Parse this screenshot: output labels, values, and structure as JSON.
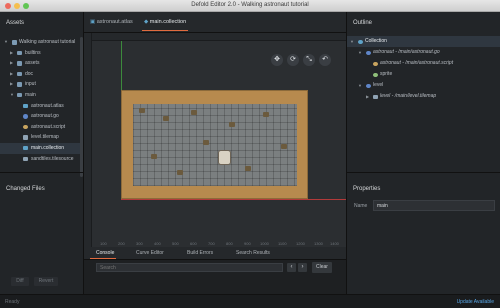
{
  "window": {
    "title": "Defold Editor 2.0 - Walking astronaut tutorial"
  },
  "assets": {
    "heading": "Assets",
    "items": [
      {
        "label": "Walking astronaut tutorial",
        "icon": "folder-icon",
        "color": "#7c9ab3",
        "expanded": true
      },
      {
        "label": "builtins",
        "icon": "folder-icon",
        "color": "#7c9ab3",
        "expanded": false
      },
      {
        "label": "assets",
        "icon": "folder-icon",
        "color": "#7c9ab3",
        "expanded": false
      },
      {
        "label": "doc",
        "icon": "folder-icon",
        "color": "#7c9ab3",
        "expanded": false
      },
      {
        "label": "input",
        "icon": "folder-icon",
        "color": "#7c9ab3",
        "expanded": false
      },
      {
        "label": "main",
        "icon": "folder-icon",
        "color": "#7c9ab3",
        "expanded": true
      },
      {
        "label": "astronaut.atlas",
        "icon": "atlas-icon",
        "color": "#5fa3c8"
      },
      {
        "label": "astronaut.go",
        "icon": "gameobject-icon",
        "color": "#5f86c8"
      },
      {
        "label": "astronaut.script",
        "icon": "script-icon",
        "color": "#c8a45f"
      },
      {
        "label": "level.tilemap",
        "icon": "tilemap-icon",
        "color": "#8fa3b4"
      },
      {
        "label": "main.collection",
        "icon": "collection-icon",
        "color": "#5fa3c8",
        "selected": true
      },
      {
        "label": "sandtiles.tilesource",
        "icon": "tilesource-icon",
        "color": "#8fa3b4"
      }
    ]
  },
  "changed_files": {
    "heading": "Changed Files",
    "diff_label": "Diff",
    "revert_label": "Revert"
  },
  "editor": {
    "tabs": [
      {
        "label": "astronaut.atlas",
        "active": false
      },
      {
        "label": "main.collection",
        "active": true
      }
    ],
    "ruler_ticks": [
      "100",
      "200",
      "300",
      "400",
      "500",
      "600",
      "700",
      "800",
      "900",
      "1000",
      "1100",
      "1200",
      "1300",
      "1400"
    ],
    "toolbar": [
      "move-tool-icon",
      "rotate-tool-icon",
      "scale-tool-icon",
      "undo-icon"
    ]
  },
  "console": {
    "tabs": [
      {
        "label": "Console",
        "active": true
      },
      {
        "label": "Curve Editor",
        "active": false
      },
      {
        "label": "Build Errors",
        "active": false
      },
      {
        "label": "Search Results",
        "active": false
      }
    ],
    "search_placeholder": "Search",
    "clear_label": "Clear",
    "prev_symbol": "‹",
    "next_symbol": "›"
  },
  "outline": {
    "heading": "Outline",
    "items": [
      {
        "label": "Collection",
        "icon": "collection-icon",
        "selected": true,
        "italic": false
      },
      {
        "label": "astronaut - /main/astronaut.go",
        "icon": "gameobject-icon",
        "italic": true
      },
      {
        "label": "astronaut - /main/astronaut.script",
        "icon": "script-icon",
        "italic": true
      },
      {
        "label": "sprite",
        "icon": "sprite-icon",
        "italic": false
      },
      {
        "label": "level",
        "icon": "gameobject-icon",
        "italic": false
      },
      {
        "label": "level - /main/level.tilemap",
        "icon": "tilemap-icon",
        "italic": true
      }
    ]
  },
  "properties": {
    "heading": "Properties",
    "name_label": "Name",
    "name_value": "main"
  },
  "status": {
    "left": "Ready",
    "update": "Update Available"
  },
  "colors": {
    "accent": "#e06b3f",
    "link": "#5aa7e6",
    "sand": "#b78a4e",
    "floor": "#7b7f80"
  }
}
